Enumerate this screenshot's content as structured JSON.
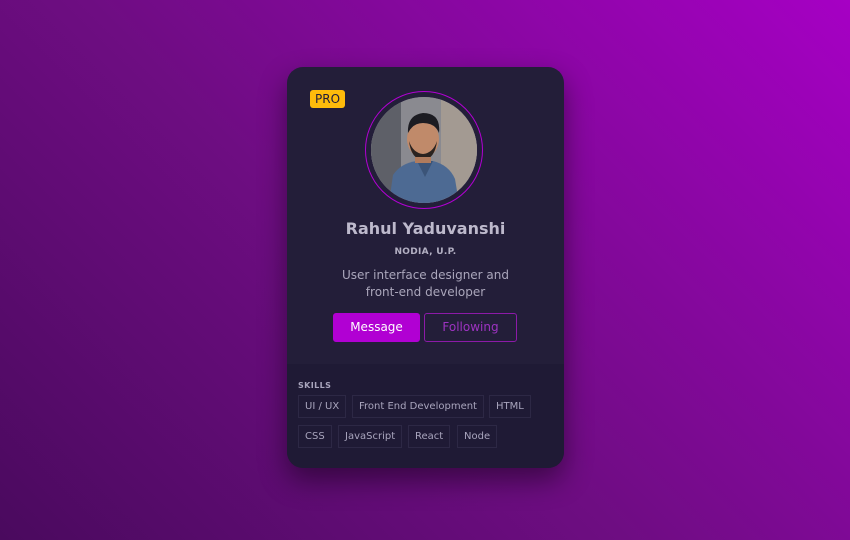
{
  "card": {
    "badge": "PRO",
    "avatar_alt": "user",
    "name": "Rahul Yaduvanshi",
    "location": "NODIA, U.P.",
    "bio_line1": "User interface designer and",
    "bio_line2": "front-end developer",
    "buttons": {
      "message": "Message",
      "following": "Following"
    }
  },
  "skills": {
    "title": "SKILLS",
    "items": [
      "UI / UX",
      "Front End Development",
      "HTML",
      "CSS",
      "JavaScript",
      "React",
      "Node"
    ]
  },
  "colors": {
    "accent": "#b100d3",
    "badge": "#febb0b",
    "card_bg": "#231e39",
    "skills_bg": "#1f1a35"
  },
  "icons": [
    "avatar-photo"
  ]
}
